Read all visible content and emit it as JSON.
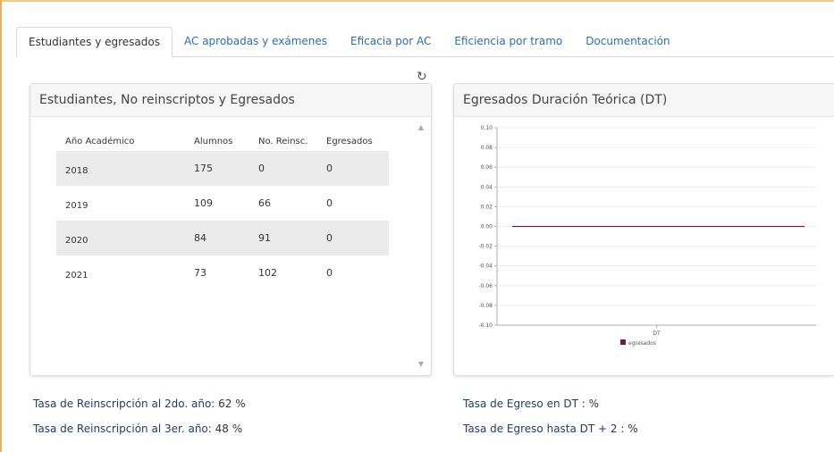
{
  "tabs": [
    {
      "label": "Estudiantes y egresados",
      "active": true
    },
    {
      "label": "AC aprobadas y exámenes",
      "active": false
    },
    {
      "label": "Eficacia por AC",
      "active": false
    },
    {
      "label": "Eficiencia por tramo",
      "active": false
    },
    {
      "label": "Documentación",
      "active": false
    }
  ],
  "refresh_icon": "refresh-icon",
  "left_panel": {
    "title": "Estudiantes, No reinscriptos y Egresados",
    "columns": [
      "Año Académico",
      "Alumnos",
      "No. Reinsc.",
      "Egresados"
    ],
    "rows": [
      [
        "2018",
        "175",
        "0",
        "0"
      ],
      [
        "2019",
        "109",
        "66",
        "0"
      ],
      [
        "2020",
        "84",
        "91",
        "0"
      ],
      [
        "2021",
        "73",
        "102",
        "0"
      ]
    ]
  },
  "right_panel": {
    "title": "Egresados Duración Teórica (DT)"
  },
  "chart_data": {
    "type": "line",
    "categories": [
      "DT"
    ],
    "series": [
      {
        "name": "egresados",
        "values": [
          0
        ],
        "color": "#6b1e4a"
      }
    ],
    "yticks": [
      "0.10",
      "0.08",
      "0.06",
      "0.04",
      "0.02",
      "0.00",
      "-0.02",
      "-0.04",
      "-0.06",
      "-0.08",
      "-0.10"
    ],
    "ylim": [
      -0.1,
      0.1
    ],
    "grid": true,
    "legend_position": "bottom"
  },
  "stats": {
    "reinsc_2do": {
      "label": "Tasa de Reinscripción al 2do. año:",
      "value": "62 %"
    },
    "reinsc_3er": {
      "label": "Tasa de Reinscripción al 3er. año:",
      "value": "48 %"
    },
    "egreso_dt": {
      "label": "Tasa de Egreso en DT :",
      "value": "%"
    },
    "egreso_dt2": {
      "label": "Tasa de Egreso hasta DT + 2 :",
      "value": "%"
    }
  }
}
